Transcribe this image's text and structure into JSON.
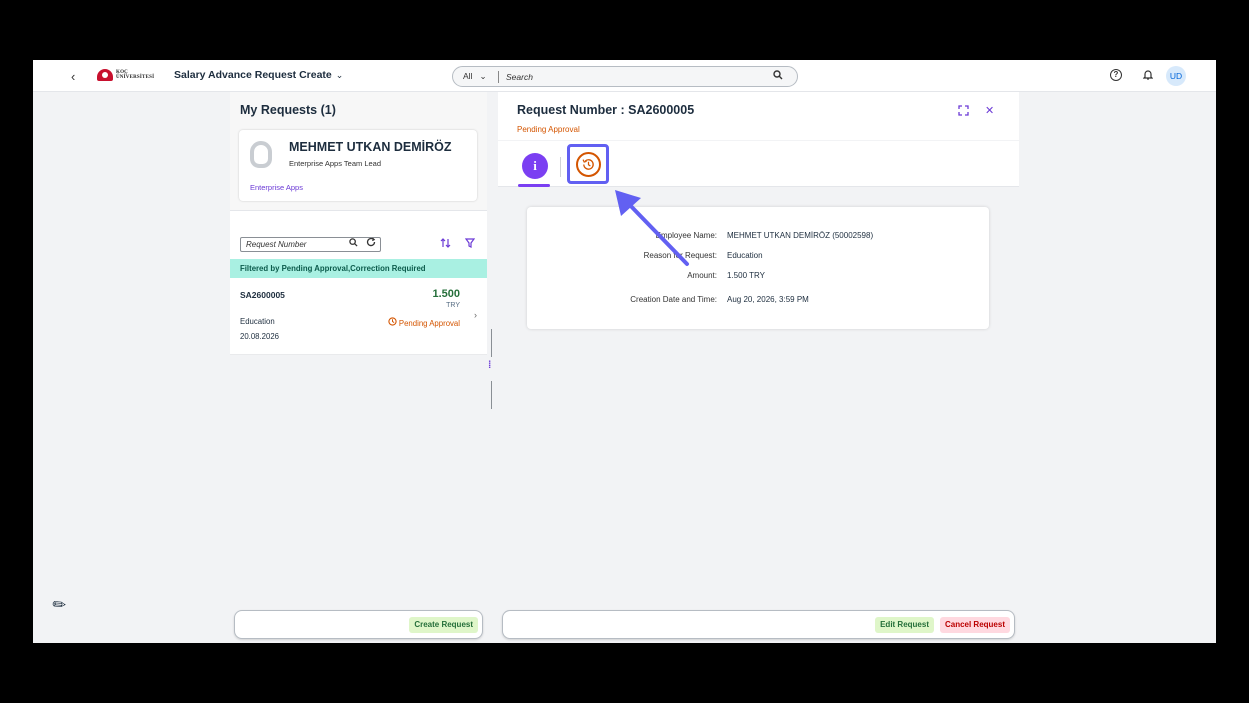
{
  "shell": {
    "back": "‹",
    "logo_line1": "KOÇ",
    "logo_line2": "ÜNİVERSİTESİ",
    "app_title": "Salary Advance Request Create",
    "title_chevron": "⌄",
    "search_scope": "All",
    "scope_chevron": "⌄",
    "search_placeholder": "Search",
    "search_icon": "search-icon",
    "help": "?",
    "bell": "🔔",
    "avatar": "UD"
  },
  "left": {
    "title": "My Requests (1)",
    "employee": {
      "name": "MEHMET UTKAN DEMİRÖZ",
      "role": "Enterprise Apps Team Lead",
      "link": "Enterprise Apps"
    },
    "search_placeholder": "Request Number",
    "filter_text": "Filtered by Pending Approval,Correction Required",
    "items": [
      {
        "id": "SA2600005",
        "amount": "1.500",
        "currency": "TRY",
        "reason": "Education",
        "status": "Pending Approval",
        "date": "20.08.2026"
      }
    ],
    "create_button": "Create Request"
  },
  "right": {
    "title": "Request Number : SA2600005",
    "status": "Pending Approval",
    "info": {
      "employee_label": "Employee Name:",
      "employee_value": "MEHMET UTKAN DEMİRÖZ (50002598)",
      "reason_label": "Reason for Request:",
      "reason_value": "Education",
      "amount_label": "Amount:",
      "amount_value": "1.500 TRY",
      "created_label": "Creation Date and Time:",
      "created_value": "Aug 20, 2026, 3:59 PM"
    },
    "edit_button": "Edit Request",
    "cancel_button": "Cancel Request"
  },
  "colors": {
    "accent": "#7b3ff2",
    "status_orange": "#d45500",
    "highlight_box": "#6260f2",
    "filter_strip": "#a9f0e2"
  }
}
